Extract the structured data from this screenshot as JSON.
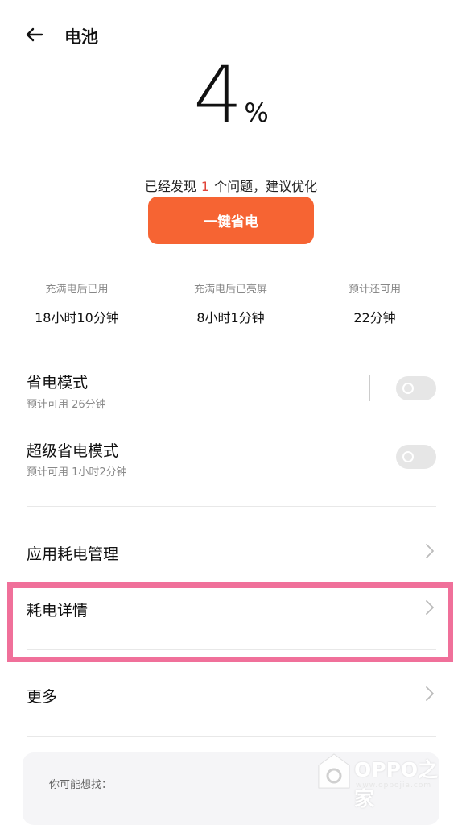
{
  "header": {
    "title": "电池",
    "back_icon": "arrow-left-icon"
  },
  "battery": {
    "level": "4",
    "unit": "%"
  },
  "issue": {
    "prefix": "已经发现",
    "count": "1",
    "suffix": "个问题，建议优化"
  },
  "optimize_button": {
    "label": "一键省电",
    "color": "#f66433"
  },
  "stats": [
    {
      "label": "充满电后已用",
      "value": "18小时10分钟"
    },
    {
      "label": "充满电后已亮屏",
      "value": "8小时1分钟"
    },
    {
      "label": "预计还可用",
      "value": "22分钟"
    }
  ],
  "power_saving": {
    "title": "省电模式",
    "subtitle": "预计可用 26分钟",
    "enabled": false
  },
  "super_saving": {
    "title": "超级省电模式",
    "subtitle": "预计可用 1小时2分钟",
    "enabled": false
  },
  "menu": {
    "app_power": "应用耗电管理",
    "power_detail": "耗电详情",
    "more": "更多"
  },
  "suggest": {
    "label": "你可能想找："
  },
  "watermark": {
    "brand": "OPPO之家",
    "url": "www.oppojia.com"
  },
  "colors": {
    "accent": "#f66433",
    "highlight": "#f0709a",
    "issue_count": "#e0453a"
  }
}
